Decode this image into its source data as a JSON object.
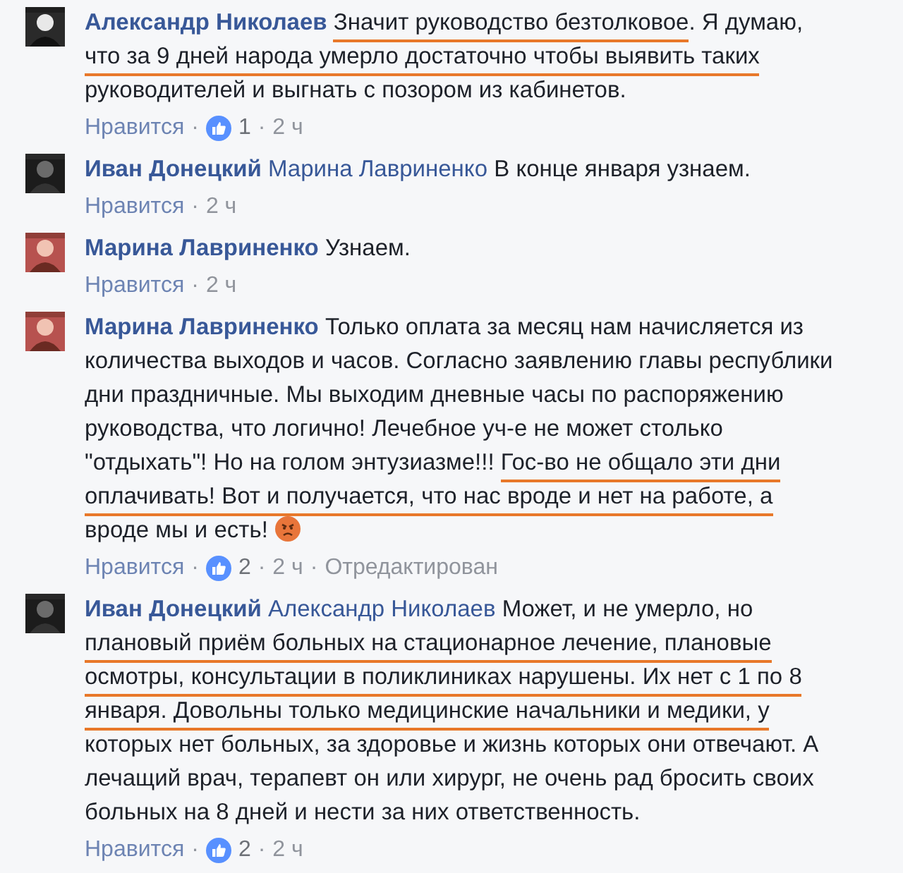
{
  "comments": [
    {
      "author": "Александр Николаев",
      "text": [
        {
          "text": "Значит руководство безтолковое",
          "underlined": true
        },
        {
          "text": ". Я думаю, ",
          "underlined": false
        },
        {
          "text": "что за 9 дней народа умерло достаточно чтобы выявить таких",
          "underlined": true
        },
        {
          "text": " руководителей и выгнать с позором из кабинетов.",
          "underlined": false
        }
      ],
      "meta": [
        {
          "kind": "like",
          "text": "Нравится"
        },
        {
          "kind": "separator",
          "text": "·"
        },
        {
          "kind": "reactions",
          "text": "1"
        },
        {
          "kind": "separator",
          "text": "·"
        },
        {
          "kind": "time",
          "text": "2 ч"
        }
      ]
    },
    {
      "author": "Иван Донецкий",
      "mention": "Марина Лавриненко",
      "text": [
        {
          "text": "В конце января узнаем.",
          "underlined": false
        }
      ],
      "meta": [
        {
          "kind": "like",
          "text": "Нравится"
        },
        {
          "kind": "separator",
          "text": "·"
        },
        {
          "kind": "time",
          "text": "2 ч"
        }
      ]
    },
    {
      "author": "Марина Лавриненко",
      "text": [
        {
          "text": "Узнаем.",
          "underlined": false
        }
      ],
      "meta": [
        {
          "kind": "like",
          "text": "Нравится"
        },
        {
          "kind": "separator",
          "text": "·"
        },
        {
          "kind": "time",
          "text": "2 ч"
        }
      ]
    },
    {
      "author": "Марина Лавриненко",
      "text": [
        {
          "text": "Только оплата за месяц нам начисляется из количества выходов и часов. Согласно заявлению главы республики дни праздничные. Мы выходим дневные часы по распоряжению руководства, что логично! Лечебное уч-е не может столько \"отдыхать\"! Но на голом энтузиазме!!! ",
          "underlined": false
        },
        {
          "text": "Гос-во не общало эти дни оплачивать! Вот и получается, что нас вроде и нет на работе, а",
          "underlined": true
        },
        {
          "text": " вроде мы и есть!",
          "underlined": false
        }
      ],
      "emoji": true,
      "meta": [
        {
          "kind": "like",
          "text": "Нравится"
        },
        {
          "kind": "separator",
          "text": "·"
        },
        {
          "kind": "reactions",
          "text": "2"
        },
        {
          "kind": "separator",
          "text": "·"
        },
        {
          "kind": "time",
          "text": "2 ч"
        },
        {
          "kind": "separator",
          "text": "·"
        },
        {
          "kind": "edited",
          "text": "Отредактирован"
        }
      ]
    },
    {
      "author": "Иван Донецкий",
      "mention": "Александр Николаев",
      "text": [
        {
          "text": "Может, и не умерло, но ",
          "underlined": false
        },
        {
          "text": "плановый приём больных на стационарное лечение, плановые осмотры, консультации в поликлиниках нарушены. Их нет с 1 по 8 января. Довольны только медицинские начальники и медики, у",
          "underlined": true
        },
        {
          "text": " которых нет больных, за здоровье и жизнь которых они отвечают. А лечащий врач, терапевт он или хирург, не очень рад бросить своих больных на 8 дней и нести за них ответственность.",
          "underlined": false
        }
      ],
      "meta": [
        {
          "kind": "like",
          "text": "Нравится"
        },
        {
          "kind": "separator",
          "text": "·"
        },
        {
          "kind": "reactions",
          "text": "2"
        },
        {
          "kind": "separator",
          "text": "·"
        },
        {
          "kind": "time",
          "text": "2 ч"
        }
      ]
    }
  ]
}
